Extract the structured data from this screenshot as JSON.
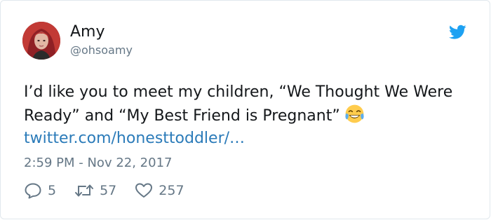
{
  "user": {
    "display_name": "Amy",
    "handle": "@ohsoamy"
  },
  "tweet": {
    "text_before_emoji": "I’d like you to meet my children, “We Thought We Were Ready” and “My Best Friend is Pregnant”",
    "emoji": "face-with-tears-of-joy",
    "link_text": "twitter.com/honesttoddler/…",
    "timestamp": "2:59 PM - Nov 22, 2017"
  },
  "actions": {
    "replies": "5",
    "retweets": "57",
    "likes": "257"
  },
  "colors": {
    "brand_blue": "#1da1f2",
    "link_blue": "#2b7bb9",
    "text_dark": "#14171a",
    "text_gray": "#657786"
  }
}
